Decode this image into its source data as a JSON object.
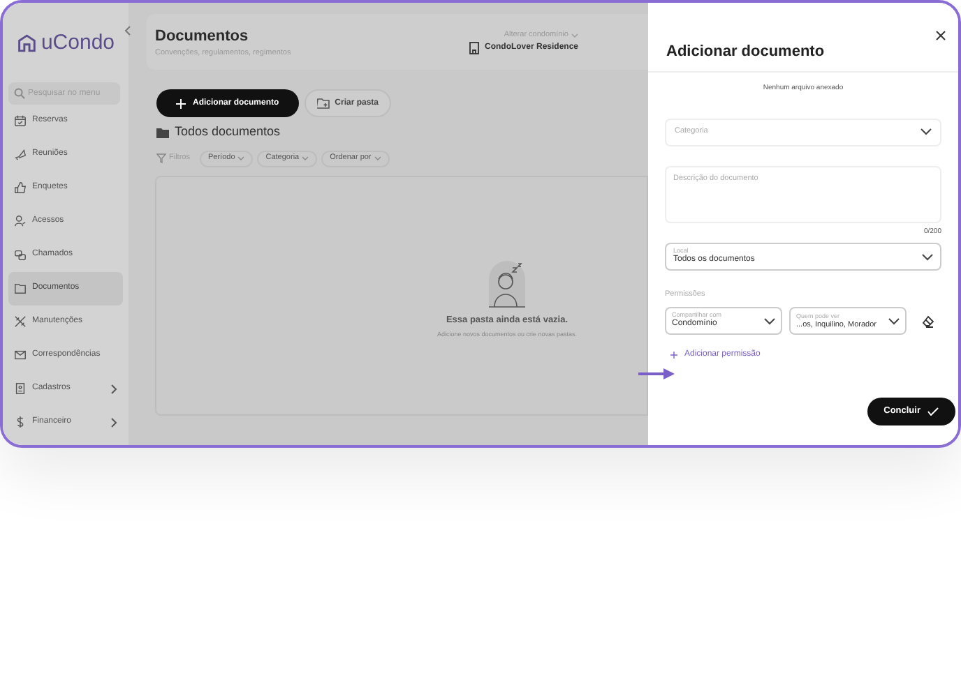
{
  "sidebar": {
    "logo": "uCondo",
    "search": {
      "placeholder": "Pesquisar no menu"
    },
    "items": [
      {
        "label": "Reservas",
        "selected": false,
        "expandable": false
      },
      {
        "label": "Reuniões",
        "selected": false,
        "expandable": false
      },
      {
        "label": "Enquetes",
        "selected": false,
        "expandable": false
      },
      {
        "label": "Acessos",
        "selected": false,
        "expandable": false
      },
      {
        "label": "Chamados",
        "selected": false,
        "expandable": false
      },
      {
        "label": "Documentos",
        "selected": true,
        "expandable": false
      },
      {
        "label": "Manutenções",
        "selected": false,
        "expandable": false
      },
      {
        "label": "Correspondências",
        "selected": false,
        "expandable": false
      },
      {
        "label": "Cadastros",
        "selected": false,
        "expandable": true
      },
      {
        "label": "Financeiro",
        "selected": false,
        "expandable": true
      }
    ]
  },
  "header": {
    "title": "Documentos",
    "subtitle": "Convenções, regulamentos, regimentos",
    "switch_label": "Alterar condomínio",
    "switch_expanded": false,
    "condo": "CondoLover Residence"
  },
  "actions": {
    "primary": "Adicionar documento",
    "secondary": "Criar pasta"
  },
  "folder_title": "Todos documentos",
  "filters": {
    "label": "Filtros",
    "items": [
      "Período",
      "Categoria",
      "Ordenar por"
    ]
  },
  "empty_state": {
    "title": "Essa pasta ainda está vazia.",
    "text": "Adicione novos documentos ou crie novas pastas."
  },
  "drawer": {
    "title": "Adicionar documento",
    "attachment_note": "Nenhum arquivo anexado",
    "category": {
      "placeholder": "Categoria"
    },
    "description": {
      "placeholder": "Descrição do documento",
      "counter": "0/200"
    },
    "location": {
      "label": "Local",
      "value": "Todos os documentos"
    },
    "permissions": {
      "title": "Permissões",
      "share": {
        "label": "Compartilhar com",
        "value": "Condomínio"
      },
      "viewers": {
        "label": "Quem pode ver",
        "value": "...os, Inquilino, Morador"
      },
      "add": "Adicionar permissão"
    },
    "submit": "Concluir"
  }
}
